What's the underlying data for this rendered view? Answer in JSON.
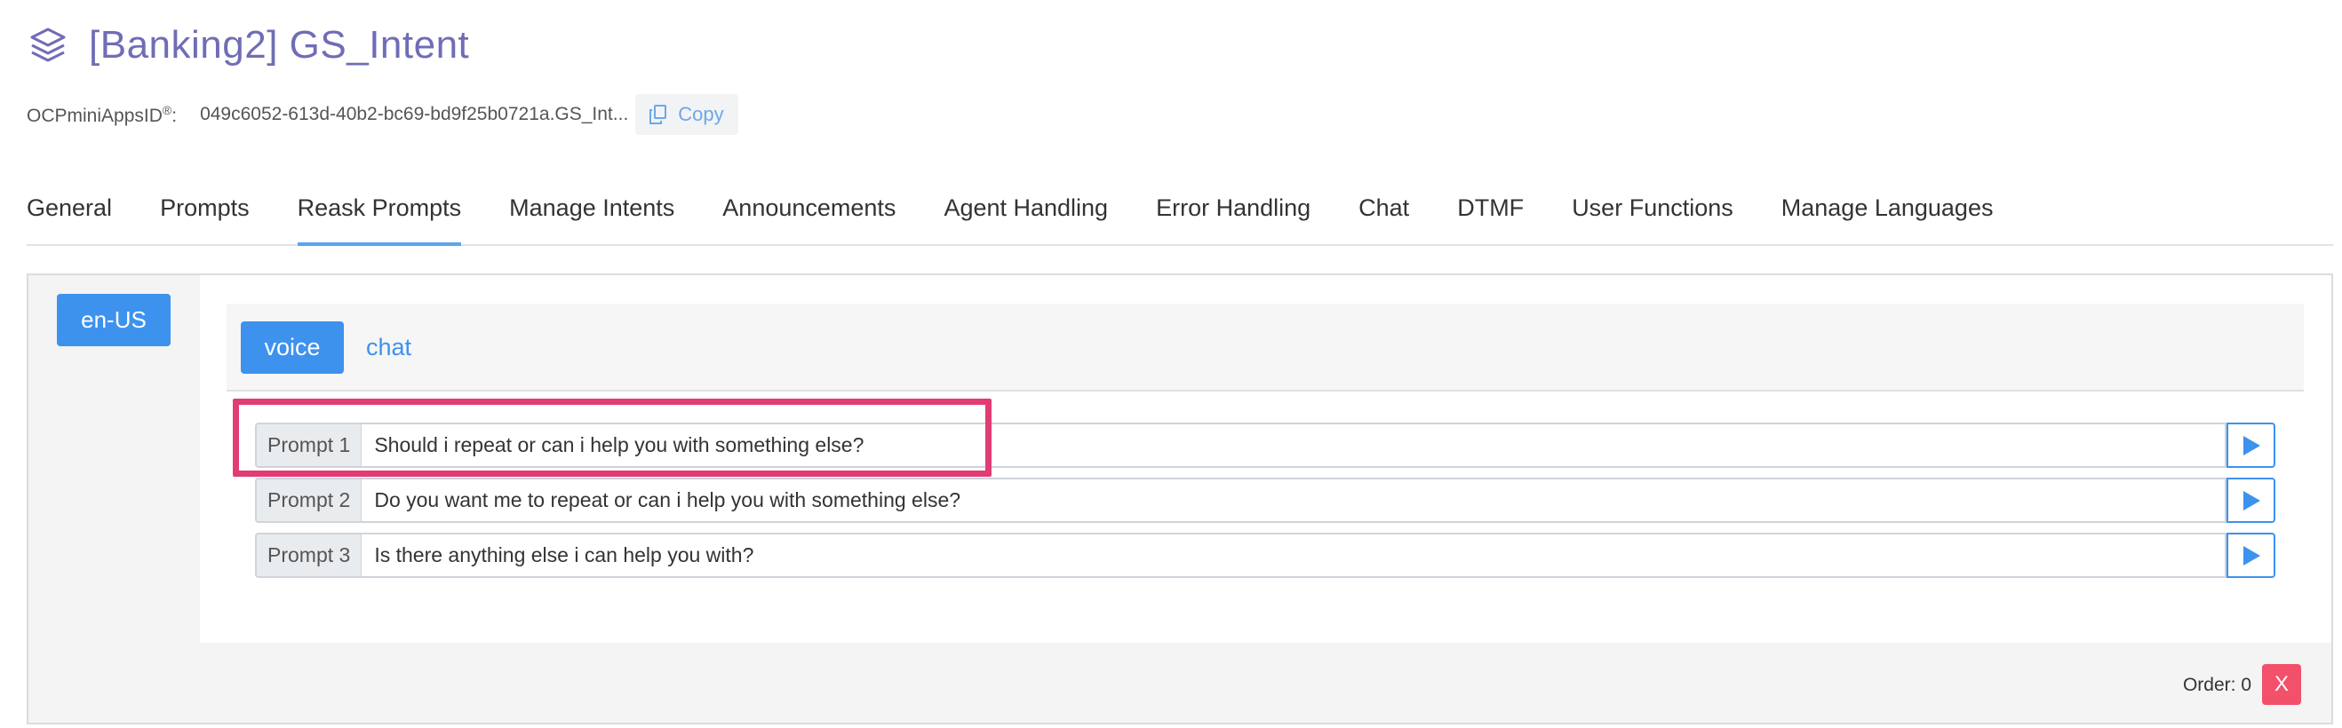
{
  "header": {
    "title": "[Banking2] GS_Intent",
    "icon": "layers-icon"
  },
  "app_id": {
    "label": "OCPminiAppsID",
    "label_sup": "®",
    "separator": ":",
    "value": "049c6052-613d-40b2-bc69-bd9f25b0721a.GS_Int...",
    "copy_label": "Copy"
  },
  "tabs": [
    {
      "label": "General",
      "active": false
    },
    {
      "label": "Prompts",
      "active": false
    },
    {
      "label": "Reask Prompts",
      "active": true
    },
    {
      "label": "Manage Intents",
      "active": false
    },
    {
      "label": "Announcements",
      "active": false
    },
    {
      "label": "Agent Handling",
      "active": false
    },
    {
      "label": "Error Handling",
      "active": false
    },
    {
      "label": "Chat",
      "active": false
    },
    {
      "label": "DTMF",
      "active": false
    },
    {
      "label": "User Functions",
      "active": false
    },
    {
      "label": "Manage Languages",
      "active": false
    }
  ],
  "language": {
    "label": "en-US"
  },
  "channels": {
    "voice": "voice",
    "chat": "chat"
  },
  "prompts": [
    {
      "label": "Prompt 1",
      "value": "Should i repeat or can i help you with something else?"
    },
    {
      "label": "Prompt 2",
      "value": "Do you want me to repeat or can i help you with something else?"
    },
    {
      "label": "Prompt 3",
      "value": "Is there anything else i can help you with?"
    }
  ],
  "footer": {
    "order_label": "Order: 0",
    "close_label": "X"
  },
  "colors": {
    "title": "#6f6db6",
    "accent": "#3d92ee",
    "highlight": "#e23c74",
    "danger": "#f2506b"
  }
}
